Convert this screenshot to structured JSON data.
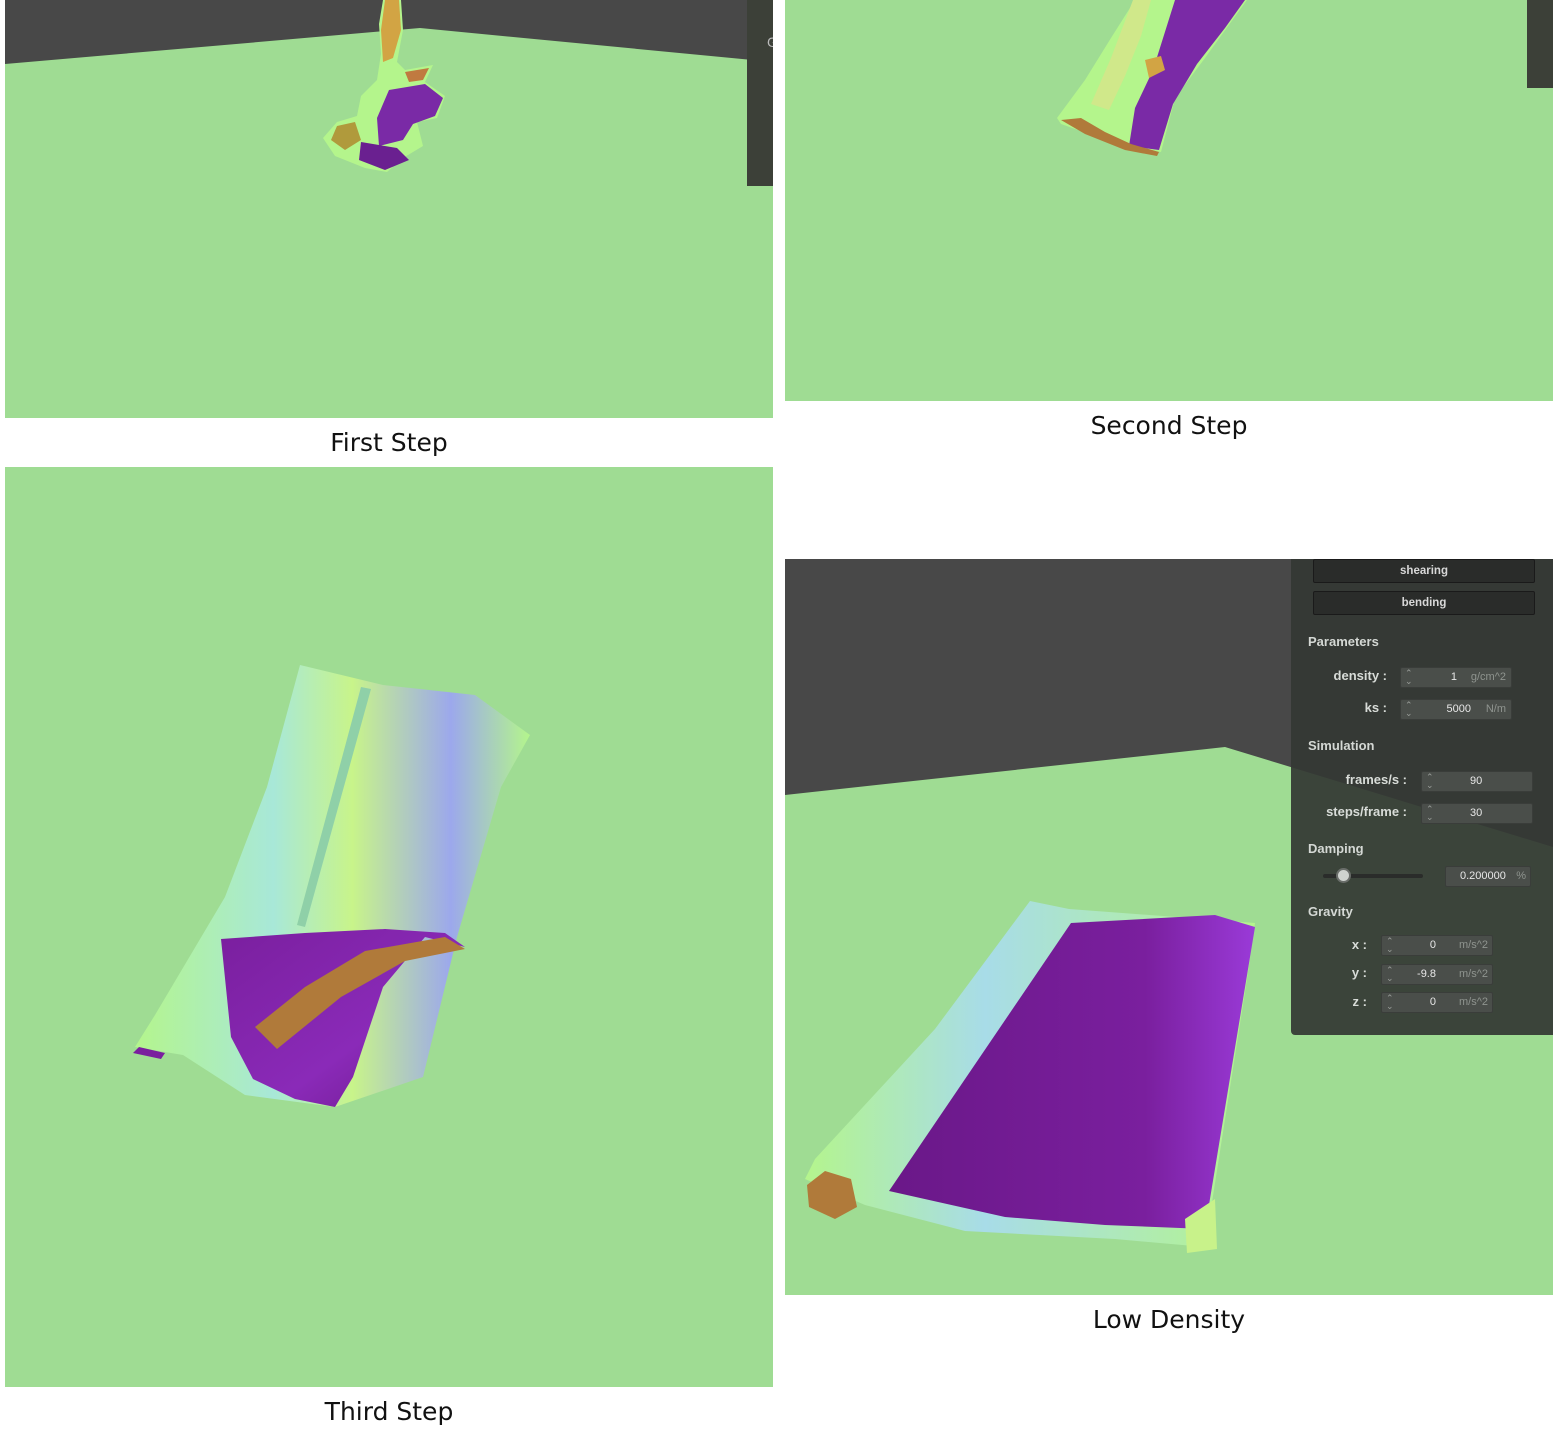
{
  "captions": {
    "first": "First Step",
    "second": "Second Step",
    "third": "Third Step",
    "low_density": "Low Density"
  },
  "colors": {
    "ground": "#9fdc93",
    "wall": "#484848",
    "cloth_light": "#b4f58c",
    "cloth_purple": "#7a1f9e"
  },
  "settings_panel": {
    "buttons": [
      "shearing",
      "bending"
    ],
    "parameters": {
      "title": "Parameters",
      "density": {
        "label": "density :",
        "value": "1",
        "unit": "g/cm^2"
      },
      "ks": {
        "label": "ks :",
        "value": "5000",
        "unit": "N/m"
      }
    },
    "simulation": {
      "title": "Simulation",
      "fps": {
        "label": "frames/s :",
        "value": "90"
      },
      "steps": {
        "label": "steps/frame :",
        "value": "30"
      }
    },
    "damping": {
      "title": "Damping",
      "value": "0.200000",
      "unit": "%",
      "slider_level": 0.2
    },
    "gravity": {
      "title": "Gravity",
      "x": {
        "label": "x :",
        "value": "0",
        "unit": "m/s^2"
      },
      "y": {
        "label": "y :",
        "value": "-9.8",
        "unit": "m/s^2"
      },
      "z": {
        "label": "z :",
        "value": "0",
        "unit": "m/s^2"
      }
    }
  }
}
